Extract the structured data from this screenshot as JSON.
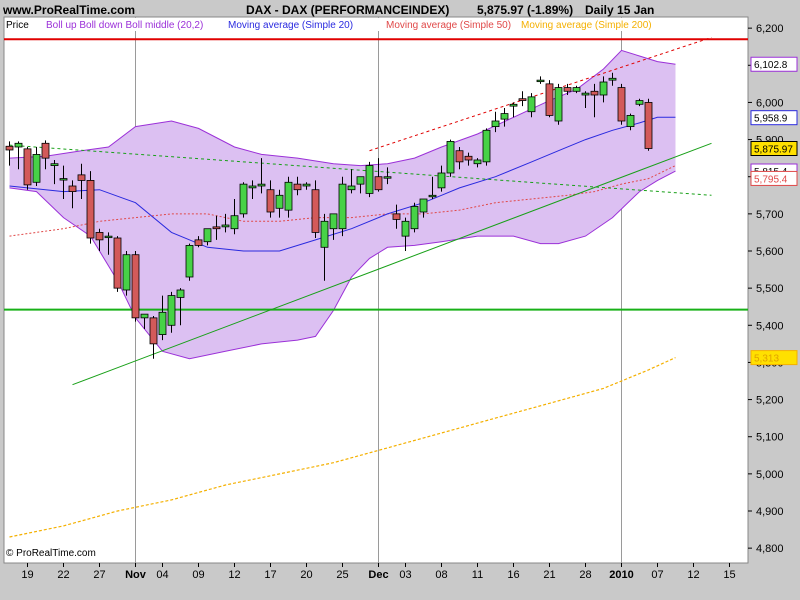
{
  "header": {
    "site": "www.ProRealTime.com",
    "instrument": "DAX - DAX (PERFORMANCEINDEX)",
    "quote": "5,875.97 (-1.89%)",
    "period": "Daily  15 Jan"
  },
  "footer": {
    "copyright": "© ProRealTime.com"
  },
  "colors": {
    "background": "#c9c9c9",
    "plot_area": "#ffffff",
    "bollinger_fill": "#dcc0f2",
    "bollinger_line": "#9b30d8",
    "sma20": "#2a2adf",
    "sma50": "#e04848",
    "sma200": "#f4b000",
    "candle_up": "#47d247",
    "candle_down": "#d35a5a",
    "resistance_line": "#e00000",
    "support_line": "#18b018",
    "trend_line": "#18a018"
  },
  "chart_data": {
    "type": "candlestick",
    "title": "DAX - DAX (PERFORMANCEINDEX)",
    "legend": [
      {
        "label": "Price",
        "color": "#000000"
      },
      {
        "label": "Boll up Boll down Boll middle (20,2)",
        "color": "#9b30d8"
      },
      {
        "label": "Moving average (Simple 20)",
        "color": "#2a2adf"
      },
      {
        "label": "Moving average (Simple 50)",
        "color": "#e04848"
      },
      {
        "label": "Moving average (Simple 200)",
        "color": "#f4b000"
      }
    ],
    "ylim": [
      4760,
      6230
    ],
    "y_ticks": [
      "6,200",
      "6,100",
      "6,000",
      "5,900",
      "5,800",
      "5,700",
      "5,600",
      "5,500",
      "5,400",
      "5,300",
      "5,200",
      "5,100",
      "5,000",
      "4,900",
      "4,800"
    ],
    "x_ticks": [
      {
        "label": "19",
        "bold": false
      },
      {
        "label": "22",
        "bold": false
      },
      {
        "label": "27",
        "bold": false
      },
      {
        "label": "Nov",
        "bold": true
      },
      {
        "label": "04",
        "bold": false
      },
      {
        "label": "09",
        "bold": false
      },
      {
        "label": "12",
        "bold": false
      },
      {
        "label": "17",
        "bold": false
      },
      {
        "label": "20",
        "bold": false
      },
      {
        "label": "25",
        "bold": false
      },
      {
        "label": "Dec",
        "bold": true
      },
      {
        "label": "03",
        "bold": false
      },
      {
        "label": "08",
        "bold": false
      },
      {
        "label": "11",
        "bold": false
      },
      {
        "label": "16",
        "bold": false
      },
      {
        "label": "21",
        "bold": false
      },
      {
        "label": "28",
        "bold": false
      },
      {
        "label": "2010",
        "bold": true
      },
      {
        "label": "07",
        "bold": false
      },
      {
        "label": "12",
        "bold": false
      },
      {
        "label": "15",
        "bold": false
      }
    ],
    "tick_slots": [
      2,
      6,
      10,
      14,
      17,
      21,
      25,
      29,
      33,
      37,
      41,
      44,
      48,
      52,
      56,
      60,
      64,
      68,
      72,
      76,
      80
    ],
    "month_separator_slots": [
      14,
      41,
      68
    ],
    "candles": [
      {
        "o": 5882,
        "h": 5895,
        "l": 5830,
        "c": 5872
      },
      {
        "o": 5880,
        "h": 5895,
        "l": 5820,
        "c": 5890
      },
      {
        "o": 5875,
        "h": 5880,
        "l": 5765,
        "c": 5778
      },
      {
        "o": 5785,
        "h": 5880,
        "l": 5775,
        "c": 5860
      },
      {
        "o": 5890,
        "h": 5898,
        "l": 5820,
        "c": 5850
      },
      {
        "o": 5830,
        "h": 5845,
        "l": 5780,
        "c": 5835
      },
      {
        "o": 5795,
        "h": 5830,
        "l": 5740,
        "c": 5795
      },
      {
        "o": 5775,
        "h": 5790,
        "l": 5715,
        "c": 5760
      },
      {
        "o": 5805,
        "h": 5835,
        "l": 5740,
        "c": 5790
      },
      {
        "o": 5790,
        "h": 5815,
        "l": 5620,
        "c": 5635
      },
      {
        "o": 5650,
        "h": 5660,
        "l": 5600,
        "c": 5630
      },
      {
        "o": 5640,
        "h": 5650,
        "l": 5590,
        "c": 5640
      },
      {
        "o": 5635,
        "h": 5640,
        "l": 5490,
        "c": 5500
      },
      {
        "o": 5495,
        "h": 5600,
        "l": 5480,
        "c": 5590
      },
      {
        "o": 5590,
        "h": 5600,
        "l": 5410,
        "c": 5420
      },
      {
        "o": 5420,
        "h": 5430,
        "l": 5390,
        "c": 5430
      },
      {
        "o": 5420,
        "h": 5425,
        "l": 5310,
        "c": 5350
      },
      {
        "o": 5375,
        "h": 5480,
        "l": 5360,
        "c": 5435
      },
      {
        "o": 5400,
        "h": 5490,
        "l": 5380,
        "c": 5480
      },
      {
        "o": 5475,
        "h": 5500,
        "l": 5400,
        "c": 5495
      },
      {
        "o": 5530,
        "h": 5620,
        "l": 5520,
        "c": 5615
      },
      {
        "o": 5630,
        "h": 5640,
        "l": 5610,
        "c": 5615
      },
      {
        "o": 5625,
        "h": 5660,
        "l": 5615,
        "c": 5660
      },
      {
        "o": 5665,
        "h": 5695,
        "l": 5630,
        "c": 5660
      },
      {
        "o": 5665,
        "h": 5700,
        "l": 5650,
        "c": 5670
      },
      {
        "o": 5660,
        "h": 5740,
        "l": 5645,
        "c": 5695
      },
      {
        "o": 5700,
        "h": 5785,
        "l": 5690,
        "c": 5780
      },
      {
        "o": 5770,
        "h": 5790,
        "l": 5740,
        "c": 5775
      },
      {
        "o": 5775,
        "h": 5850,
        "l": 5755,
        "c": 5780
      },
      {
        "o": 5765,
        "h": 5790,
        "l": 5690,
        "c": 5705
      },
      {
        "o": 5715,
        "h": 5765,
        "l": 5690,
        "c": 5750
      },
      {
        "o": 5710,
        "h": 5800,
        "l": 5690,
        "c": 5785
      },
      {
        "o": 5780,
        "h": 5800,
        "l": 5750,
        "c": 5765
      },
      {
        "o": 5775,
        "h": 5785,
        "l": 5765,
        "c": 5780
      },
      {
        "o": 5765,
        "h": 5790,
        "l": 5635,
        "c": 5650
      },
      {
        "o": 5610,
        "h": 5700,
        "l": 5520,
        "c": 5680
      },
      {
        "o": 5660,
        "h": 5700,
        "l": 5630,
        "c": 5700
      },
      {
        "o": 5660,
        "h": 5800,
        "l": 5640,
        "c": 5780
      },
      {
        "o": 5765,
        "h": 5820,
        "l": 5755,
        "c": 5775
      },
      {
        "o": 5780,
        "h": 5800,
        "l": 5755,
        "c": 5800
      },
      {
        "o": 5755,
        "h": 5840,
        "l": 5745,
        "c": 5830
      },
      {
        "o": 5800,
        "h": 5850,
        "l": 5760,
        "c": 5765
      },
      {
        "o": 5800,
        "h": 5825,
        "l": 5780,
        "c": 5800
      },
      {
        "o": 5700,
        "h": 5725,
        "l": 5660,
        "c": 5685
      },
      {
        "o": 5640,
        "h": 5690,
        "l": 5600,
        "c": 5680
      },
      {
        "o": 5660,
        "h": 5730,
        "l": 5650,
        "c": 5720
      },
      {
        "o": 5705,
        "h": 5740,
        "l": 5690,
        "c": 5740
      },
      {
        "o": 5750,
        "h": 5800,
        "l": 5740,
        "c": 5750
      },
      {
        "o": 5770,
        "h": 5830,
        "l": 5760,
        "c": 5810
      },
      {
        "o": 5810,
        "h": 5900,
        "l": 5800,
        "c": 5895
      },
      {
        "o": 5870,
        "h": 5880,
        "l": 5820,
        "c": 5840
      },
      {
        "o": 5855,
        "h": 5865,
        "l": 5830,
        "c": 5845
      },
      {
        "o": 5835,
        "h": 5850,
        "l": 5825,
        "c": 5845
      },
      {
        "o": 5840,
        "h": 5930,
        "l": 5830,
        "c": 5925
      },
      {
        "o": 5935,
        "h": 5975,
        "l": 5920,
        "c": 5950
      },
      {
        "o": 5955,
        "h": 5985,
        "l": 5935,
        "c": 5970
      },
      {
        "o": 5990,
        "h": 6000,
        "l": 5960,
        "c": 5995
      },
      {
        "o": 6010,
        "h": 6030,
        "l": 5990,
        "c": 6005
      },
      {
        "o": 5975,
        "h": 6025,
        "l": 5960,
        "c": 6015
      },
      {
        "o": 6060,
        "h": 6070,
        "l": 6050,
        "c": 6060
      },
      {
        "o": 6050,
        "h": 6060,
        "l": 5960,
        "c": 5965
      },
      {
        "o": 5950,
        "h": 6050,
        "l": 5940,
        "c": 6040
      },
      {
        "o": 6040,
        "h": 6050,
        "l": 6020,
        "c": 6030
      },
      {
        "o": 6030,
        "h": 6045,
        "l": 6025,
        "c": 6040
      },
      {
        "o": 6020,
        "h": 6030,
        "l": 5985,
        "c": 6025
      },
      {
        "o": 6030,
        "h": 6050,
        "l": 5960,
        "c": 6020
      },
      {
        "o": 6020,
        "h": 6070,
        "l": 6000,
        "c": 6055
      },
      {
        "o": 6060,
        "h": 6080,
        "l": 6045,
        "c": 6065
      },
      {
        "o": 6040,
        "h": 6050,
        "l": 5940,
        "c": 5950
      },
      {
        "o": 5935,
        "h": 5970,
        "l": 5925,
        "c": 5965
      },
      {
        "o": 5995,
        "h": 6010,
        "l": 5990,
        "c": 6005
      },
      {
        "o": 6000,
        "h": 6010,
        "l": 5870,
        "c": 5876
      }
    ],
    "sma20": [
      [
        0,
        5775
      ],
      [
        6,
        5760
      ],
      [
        10,
        5765
      ],
      [
        14,
        5730
      ],
      [
        18,
        5650
      ],
      [
        22,
        5610
      ],
      [
        26,
        5600
      ],
      [
        30,
        5600
      ],
      [
        34,
        5630
      ],
      [
        38,
        5660
      ],
      [
        42,
        5700
      ],
      [
        46,
        5730
      ],
      [
        48,
        5750
      ],
      [
        50,
        5770
      ],
      [
        54,
        5800
      ],
      [
        58,
        5840
      ],
      [
        61,
        5870
      ],
      [
        64,
        5900
      ],
      [
        67,
        5925
      ],
      [
        70,
        5945
      ],
      [
        72,
        5960
      ],
      [
        74,
        5960
      ]
    ],
    "sma50": [
      [
        0,
        5640
      ],
      [
        6,
        5660
      ],
      [
        10,
        5680
      ],
      [
        14,
        5690
      ],
      [
        18,
        5700
      ],
      [
        22,
        5700
      ],
      [
        26,
        5680
      ],
      [
        30,
        5680
      ],
      [
        34,
        5690
      ],
      [
        38,
        5690
      ],
      [
        42,
        5700
      ],
      [
        46,
        5700
      ],
      [
        50,
        5710
      ],
      [
        54,
        5730
      ],
      [
        58,
        5740
      ],
      [
        62,
        5750
      ],
      [
        65,
        5760
      ],
      [
        68,
        5780
      ],
      [
        71,
        5795
      ],
      [
        74,
        5830
      ]
    ],
    "sma200": [
      [
        0,
        4830
      ],
      [
        6,
        4860
      ],
      [
        12,
        4900
      ],
      [
        18,
        4930
      ],
      [
        24,
        4970
      ],
      [
        30,
        5000
      ],
      [
        36,
        5030
      ],
      [
        42,
        5070
      ],
      [
        48,
        5110
      ],
      [
        54,
        5150
      ],
      [
        60,
        5190
      ],
      [
        66,
        5230
      ],
      [
        71,
        5280
      ],
      [
        74,
        5313
      ]
    ],
    "boll_upper": [
      [
        0,
        5850
      ],
      [
        4,
        5855
      ],
      [
        8,
        5870
      ],
      [
        11,
        5880
      ],
      [
        14,
        5935
      ],
      [
        18,
        5950
      ],
      [
        21,
        5930
      ],
      [
        25,
        5880
      ],
      [
        28,
        5860
      ],
      [
        32,
        5850
      ],
      [
        36,
        5835
      ],
      [
        39,
        5830
      ],
      [
        42,
        5835
      ],
      [
        45,
        5850
      ],
      [
        48,
        5880
      ],
      [
        52,
        5915
      ],
      [
        56,
        5960
      ],
      [
        60,
        6005
      ],
      [
        63,
        6035
      ],
      [
        66,
        6090
      ],
      [
        68,
        6140
      ],
      [
        70,
        6125
      ],
      [
        72,
        6110
      ],
      [
        74,
        6102.8
      ]
    ],
    "boll_lower": [
      [
        0,
        5770
      ],
      [
        3,
        5760
      ],
      [
        6,
        5690
      ],
      [
        9,
        5640
      ],
      [
        12,
        5520
      ],
      [
        14,
        5420
      ],
      [
        17,
        5330
      ],
      [
        20,
        5310
      ],
      [
        24,
        5330
      ],
      [
        28,
        5350
      ],
      [
        32,
        5360
      ],
      [
        34,
        5370
      ],
      [
        36,
        5440
      ],
      [
        38,
        5530
      ],
      [
        40,
        5580
      ],
      [
        42,
        5610
      ],
      [
        45,
        5615
      ],
      [
        48,
        5625
      ],
      [
        52,
        5640
      ],
      [
        56,
        5640
      ],
      [
        59,
        5620
      ],
      [
        61,
        5620
      ],
      [
        64,
        5640
      ],
      [
        67,
        5690
      ],
      [
        70,
        5760
      ],
      [
        72,
        5790
      ],
      [
        74,
        5815
      ]
    ],
    "resistance_level": 6170,
    "support_level": 5442,
    "trendlines": [
      {
        "name": "rising-support",
        "points": [
          [
            7,
            5240
          ],
          [
            78,
            5890
          ]
        ],
        "style": "solid",
        "color": "#18a018"
      },
      {
        "name": "declining",
        "points": [
          [
            0,
            5885
          ],
          [
            78,
            5750
          ]
        ],
        "style": "dotted",
        "color": "#18a018"
      },
      {
        "name": "upper-channel",
        "points": [
          [
            40,
            5870
          ],
          [
            78,
            6175
          ]
        ],
        "style": "dotted",
        "color": "#e00000"
      }
    ],
    "price_labels": [
      {
        "text": "6,102.8",
        "value": 6102.8,
        "fill": "#ffffff",
        "text_color": "#000000",
        "border": "#9b30d8"
      },
      {
        "text": "5,958.9",
        "value": 5958.9,
        "fill": "#ffffff",
        "text_color": "#000000",
        "border": "#2a2adf"
      },
      {
        "text": "5,875.97",
        "value": 5875.97,
        "fill": "#ffe000",
        "text_color": "#000000",
        "border": "#000000"
      },
      {
        "text": "5,815.4",
        "value": 5815.4,
        "fill": "#ffffff",
        "text_color": "#000000",
        "border": "#9b30d8"
      },
      {
        "text": "5,795.4",
        "value": 5795.4,
        "fill": "#ffffff",
        "text_color": "#e04848",
        "border": "#e04848"
      },
      {
        "text": "5,313",
        "value": 5313,
        "fill": "#ffe000",
        "text_color": "#e0a000",
        "border": "#f4b000"
      }
    ]
  }
}
